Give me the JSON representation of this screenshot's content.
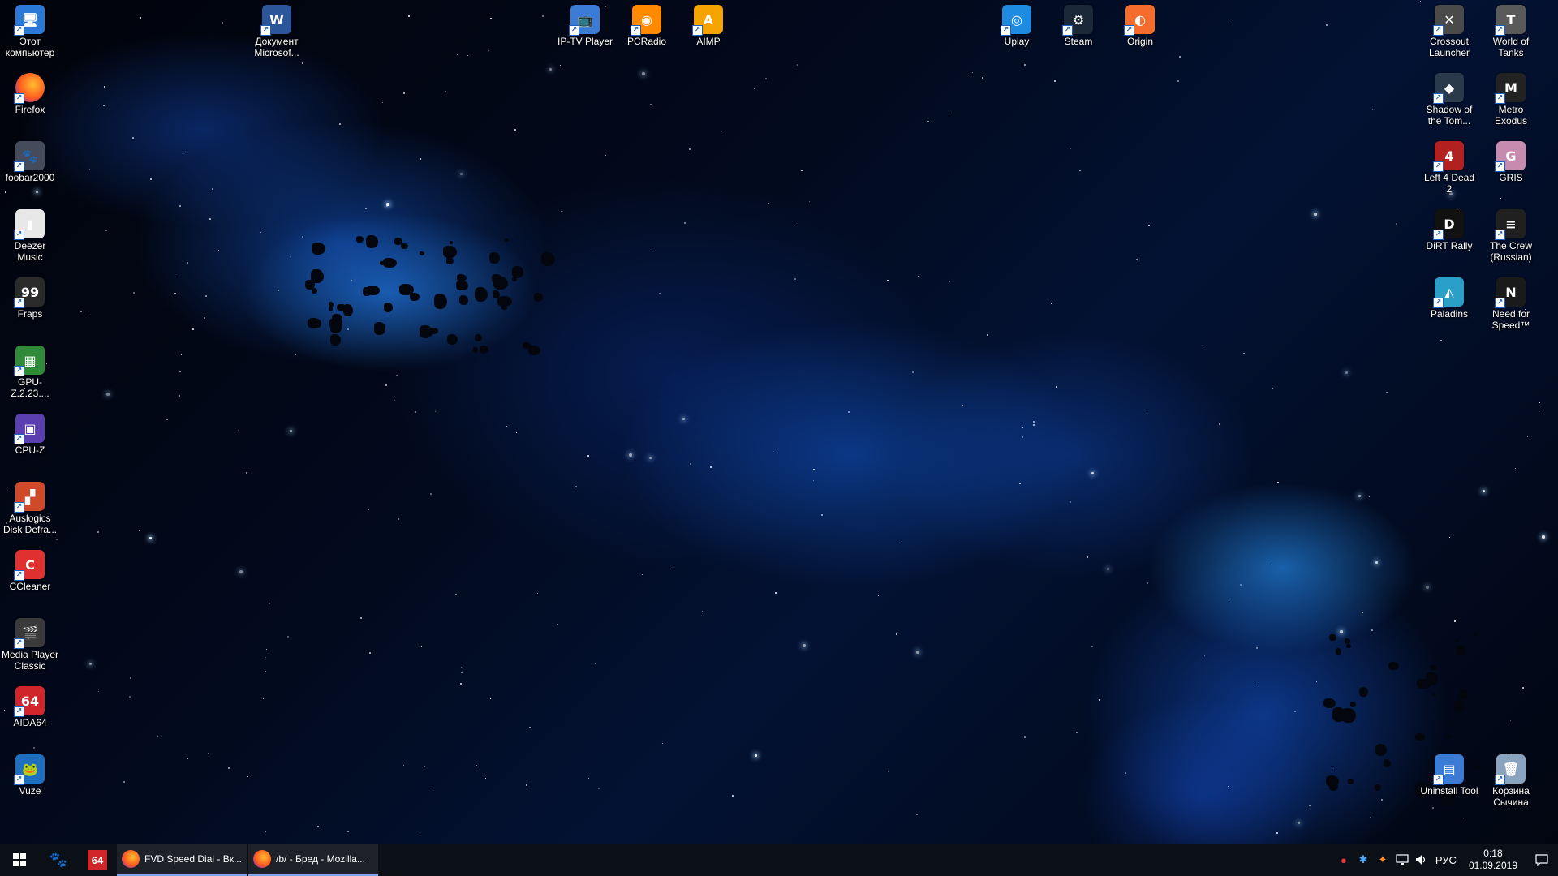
{
  "desktop": {
    "left_column": [
      {
        "label": "Этот компьютер",
        "icon": "this-pc-icon",
        "glyph": "🖥",
        "color": "#2b79d6"
      },
      {
        "label": "Firefox",
        "icon": "firefox-icon",
        "glyph": "",
        "color": "#ff7a1f"
      },
      {
        "label": "foobar2000",
        "icon": "foobar2000-icon",
        "glyph": "🐾",
        "color": "#444c5c"
      },
      {
        "label": "Deezer Music",
        "icon": "deezer-icon",
        "glyph": "▮",
        "color": "#e8e8e8"
      },
      {
        "label": "Fraps",
        "icon": "fraps-icon",
        "glyph": "99",
        "color": "#2a2a2a"
      },
      {
        "label": "GPU-Z.2.23....",
        "icon": "gpu-z-icon",
        "glyph": "▦",
        "color": "#2f8a3a"
      },
      {
        "label": "CPU-Z",
        "icon": "cpu-z-icon",
        "glyph": "▣",
        "color": "#5a3fb0"
      },
      {
        "label": "Auslogics Disk Defra...",
        "icon": "auslogics-icon",
        "glyph": "▞",
        "color": "#d04a2a"
      },
      {
        "label": "CCleaner",
        "icon": "ccleaner-icon",
        "glyph": "C",
        "color": "#e03030"
      },
      {
        "label": "Media Player Classic",
        "icon": "mpc-icon",
        "glyph": "🎬",
        "color": "#3a3a3a"
      },
      {
        "label": "AIDA64",
        "icon": "aida64-icon",
        "glyph": "64",
        "color": "#d0252a"
      },
      {
        "label": "Vuze",
        "icon": "vuze-icon",
        "glyph": "🐸",
        "color": "#1f6fc0"
      }
    ],
    "top_row_1": [
      {
        "label": "Документ Microsof...",
        "icon": "word-document-icon",
        "glyph": "W",
        "color": "#2b579a"
      }
    ],
    "top_row_2": [
      {
        "label": "IP-TV Player",
        "icon": "iptv-player-icon",
        "glyph": "📺",
        "color": "#3a7bd5"
      },
      {
        "label": "PCRadio",
        "icon": "pcradio-icon",
        "glyph": "◉",
        "color": "#ff8a00"
      },
      {
        "label": "AIMP",
        "icon": "aimp-icon",
        "glyph": "A",
        "color": "#f5a300"
      }
    ],
    "top_row_3": [
      {
        "label": "Uplay",
        "icon": "uplay-icon",
        "glyph": "◎",
        "color": "#1e8be0"
      },
      {
        "label": "Steam",
        "icon": "steam-icon",
        "glyph": "⚙",
        "color": "#1b2838"
      },
      {
        "label": "Origin",
        "icon": "origin-icon",
        "glyph": "◐",
        "color": "#f56c2d"
      }
    ],
    "right_col_a": [
      {
        "label": "Crossout Launcher",
        "icon": "crossout-icon",
        "glyph": "✕",
        "color": "#4a4a4a"
      },
      {
        "label": "Shadow of the Tom...",
        "icon": "shadow-tomb-raider-icon",
        "glyph": "◆",
        "color": "#2b3a4a"
      },
      {
        "label": "Left 4 Dead 2",
        "icon": "left4dead2-icon",
        "glyph": "4",
        "color": "#b32020"
      },
      {
        "label": "DiRT Rally",
        "icon": "dirt-rally-icon",
        "glyph": "D",
        "color": "#111111"
      },
      {
        "label": "Paladins",
        "icon": "paladins-icon",
        "glyph": "◭",
        "color": "#2aa0c8"
      }
    ],
    "right_col_b": [
      {
        "label": "World of Tanks",
        "icon": "world-of-tanks-icon",
        "glyph": "T",
        "color": "#5a5a5a"
      },
      {
        "label": "Metro Exodus",
        "icon": "metro-exodus-icon",
        "glyph": "M",
        "color": "#222222"
      },
      {
        "label": "GRIS",
        "icon": "gris-icon",
        "glyph": "G",
        "color": "#c78bb0"
      },
      {
        "label": "The Crew (Russian)",
        "icon": "the-crew-icon",
        "glyph": "≡",
        "color": "#202020"
      },
      {
        "label": "Need for Speed™",
        "icon": "need-for-speed-icon",
        "glyph": "N",
        "color": "#1a1a1a"
      }
    ],
    "bottom_right": [
      {
        "label": "Uninstall Tool",
        "icon": "uninstall-tool-icon",
        "glyph": "▤",
        "color": "#3a7bd5"
      },
      {
        "label": "Корзина Сычина",
        "icon": "recycle-bin-icon",
        "glyph": "🗑",
        "color": "#8aa4c0"
      }
    ]
  },
  "taskbar": {
    "pinned_aida_label": "64",
    "windows": [
      {
        "title": "FVD Speed Dial - Вк..."
      },
      {
        "title": "/b/ - Бред - Mozilla..."
      }
    ],
    "tray": {
      "language": "РУС",
      "time": "0:18",
      "date": "01.09.2019"
    }
  }
}
